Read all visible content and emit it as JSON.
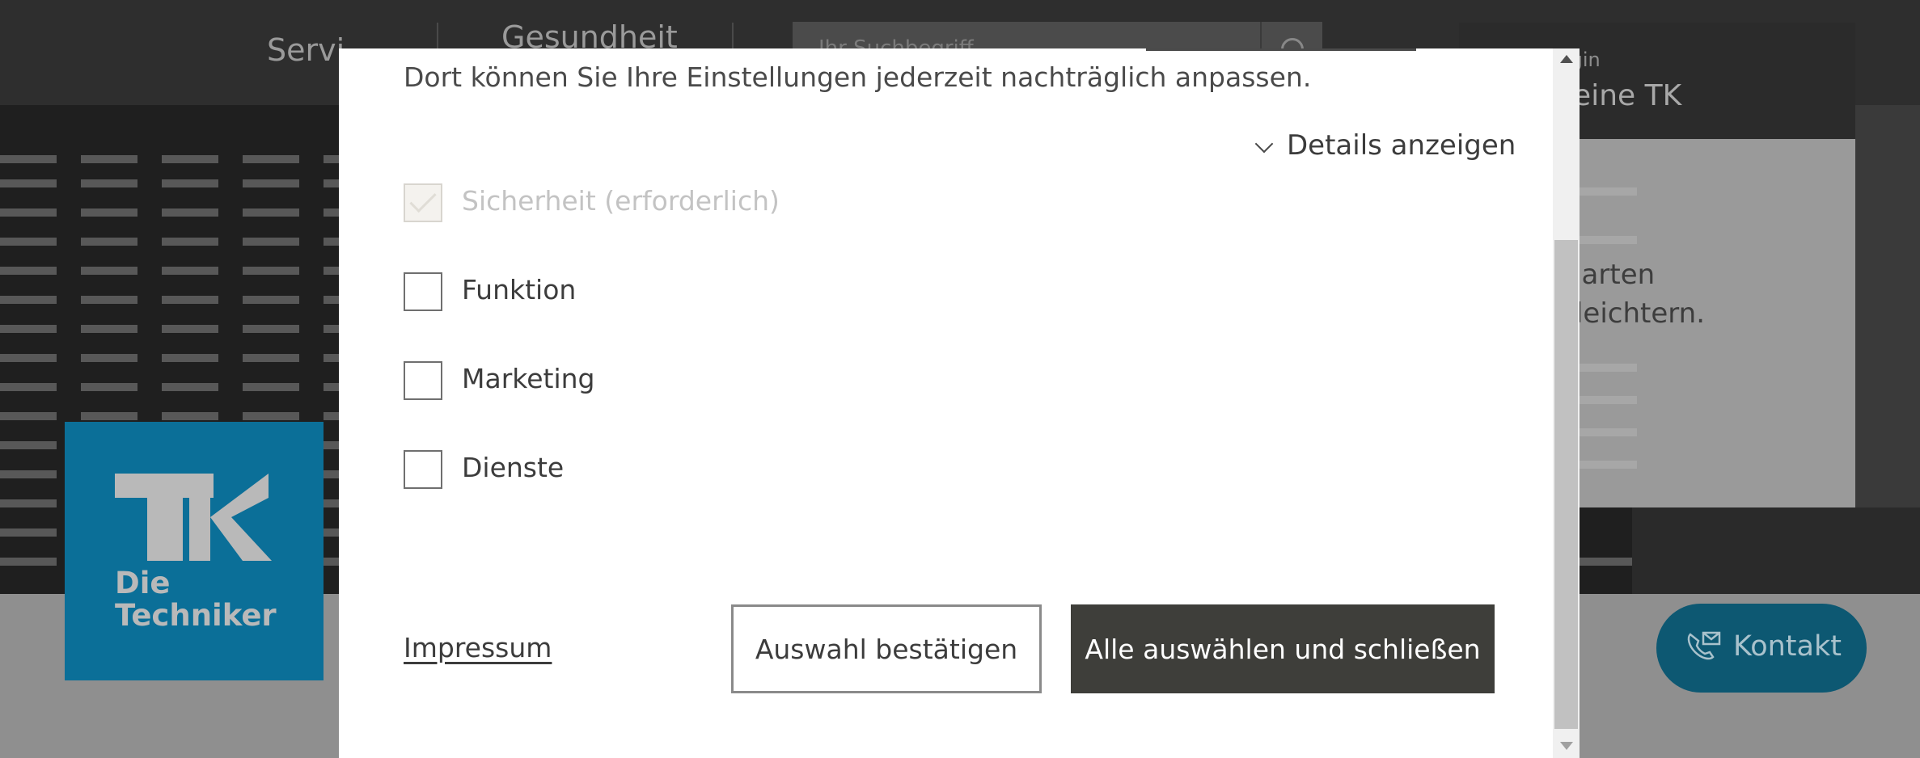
{
  "background": {
    "nav": [
      "Servi",
      "Gesundheit"
    ],
    "search_placeholder": "Ihr Suchbegriff",
    "login_small": "Login",
    "login_big": "Meine TK",
    "side_text": [
      "narten",
      "rleichtern."
    ],
    "logo_lines": [
      "Die",
      "Techniker"
    ],
    "logo_letters": "TK",
    "kontakt_label": "Kontakt",
    "colors": {
      "brand_blue": "#0b6f98",
      "kontakt_bg": "#0d5872"
    }
  },
  "modal": {
    "intro_text": "Dort können Sie Ihre Einstellungen jederzeit nachträglich anpassen.",
    "details_label": "Details anzeigen",
    "options": [
      {
        "label": "Sicherheit (erforderlich)",
        "checked": true,
        "disabled": true
      },
      {
        "label": "Funktion",
        "checked": false,
        "disabled": false
      },
      {
        "label": "Marketing",
        "checked": false,
        "disabled": false
      },
      {
        "label": "Dienste",
        "checked": false,
        "disabled": false
      }
    ],
    "impressum_label": "Impressum",
    "confirm_label": "Auswahl bestätigen",
    "accept_all_label": "Alle auswählen und schließen",
    "colors": {
      "accept_all_bg": "#3e3e3a"
    }
  }
}
